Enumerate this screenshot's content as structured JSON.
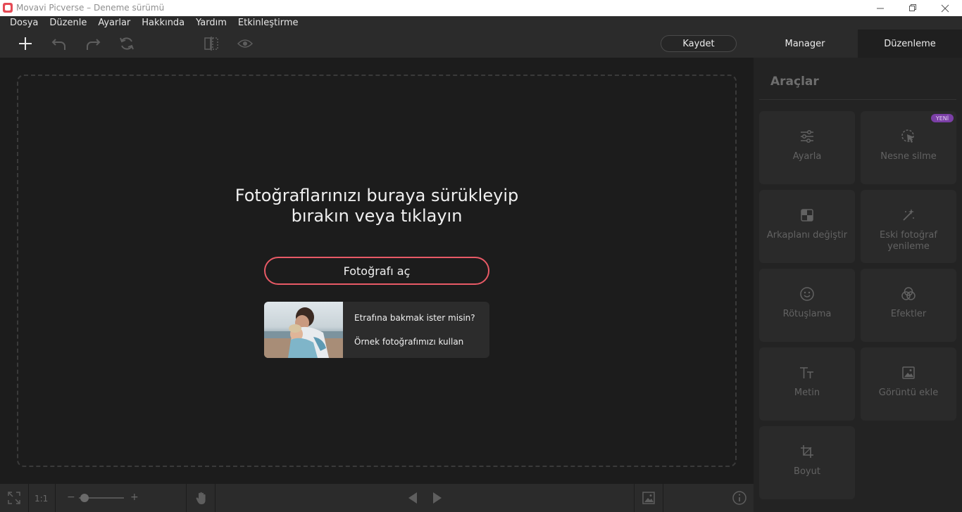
{
  "window": {
    "title": "Movavi Picverse – Deneme sürümü"
  },
  "menu": {
    "items": [
      "Dosya",
      "Düzenle",
      "Ayarlar",
      "Hakkında",
      "Yardım",
      "Etkinleştirme"
    ]
  },
  "toolbar": {
    "save_label": "Kaydet",
    "tabs": [
      {
        "label": "Manager",
        "active": false
      },
      {
        "label": "Düzenleme",
        "active": true
      }
    ]
  },
  "canvas": {
    "drop_line1": "Fotoğraflarınızı buraya sürükleyip",
    "drop_line2": "bırakın veya tıklayın",
    "open_button": "Fotoğrafı aç",
    "sample_question": "Etrafına bakmak ister misin?",
    "sample_use": "Örnek fotoğrafımızı kullan"
  },
  "statusbar": {
    "zoom_ratio": "1:1",
    "zoom_minus": "−",
    "zoom_plus": "+"
  },
  "sidebar": {
    "title": "Araçlar",
    "badge": "YENİ",
    "tools": [
      {
        "label": "Ayarla",
        "icon": "sliders-icon"
      },
      {
        "label": "Nesne silme",
        "icon": "object-remove-icon"
      },
      {
        "label": "Arkaplanı değiştir",
        "icon": "background-icon"
      },
      {
        "label": "Eski fotoğraf yenileme",
        "icon": "magic-wand-icon"
      },
      {
        "label": "Rötuşlama",
        "icon": "face-icon"
      },
      {
        "label": "Efektler",
        "icon": "effects-icon"
      },
      {
        "label": "Metin",
        "icon": "text-icon"
      },
      {
        "label": "Görüntü ekle",
        "icon": "add-image-icon"
      },
      {
        "label": "Boyut",
        "icon": "crop-icon"
      }
    ]
  },
  "colors": {
    "accent": "#e85a66",
    "badge": "#7b3fa6",
    "background": "#1c1c1c",
    "panel": "#2b2b2b"
  }
}
